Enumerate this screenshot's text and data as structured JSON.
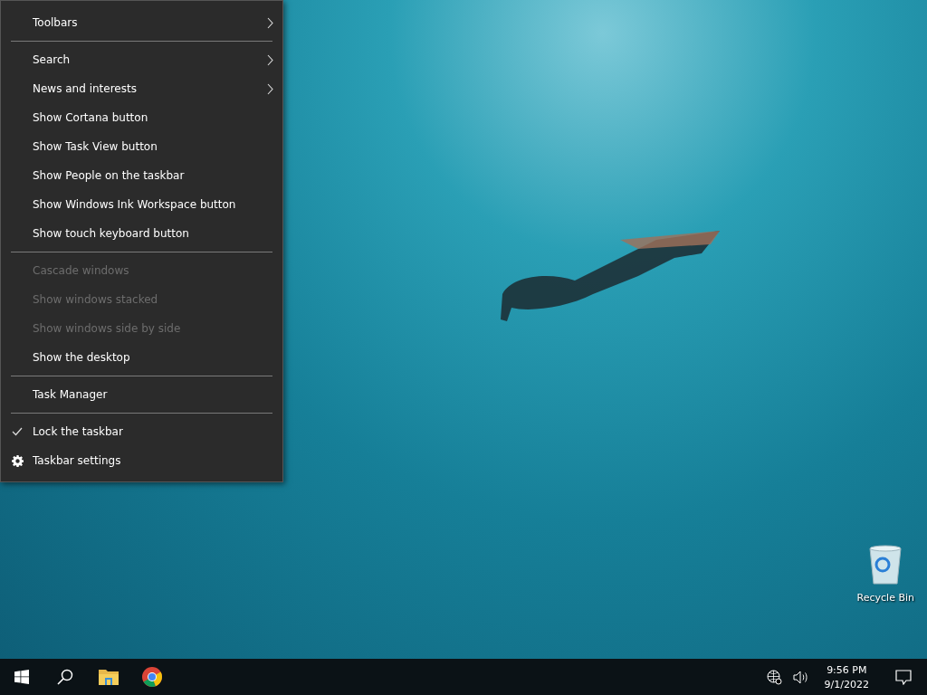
{
  "context_menu": {
    "items": [
      {
        "kind": "submenu",
        "label": "Toolbars",
        "disabled": false
      },
      {
        "kind": "separator"
      },
      {
        "kind": "submenu",
        "label": "Search",
        "disabled": false
      },
      {
        "kind": "submenu",
        "label": "News and interests",
        "disabled": false
      },
      {
        "kind": "command",
        "label": "Show Cortana button",
        "disabled": false
      },
      {
        "kind": "command",
        "label": "Show Task View button",
        "disabled": false
      },
      {
        "kind": "command",
        "label": "Show People on the taskbar",
        "disabled": false
      },
      {
        "kind": "command",
        "label": "Show Windows Ink Workspace button",
        "disabled": false
      },
      {
        "kind": "command",
        "label": "Show touch keyboard button",
        "disabled": false
      },
      {
        "kind": "separator"
      },
      {
        "kind": "command",
        "label": "Cascade windows",
        "disabled": true
      },
      {
        "kind": "command",
        "label": "Show windows stacked",
        "disabled": true
      },
      {
        "kind": "command",
        "label": "Show windows side by side",
        "disabled": true
      },
      {
        "kind": "command",
        "label": "Show the desktop",
        "disabled": false
      },
      {
        "kind": "separator"
      },
      {
        "kind": "command",
        "label": "Task Manager",
        "disabled": false
      },
      {
        "kind": "separator"
      },
      {
        "kind": "toggle",
        "label": "Lock the taskbar",
        "disabled": false,
        "checked": true
      },
      {
        "kind": "settings",
        "label": "Taskbar settings",
        "disabled": false
      }
    ]
  },
  "desktop_icons": [
    {
      "label": "Recycle Bin"
    }
  ],
  "taskbar": {
    "clock": {
      "time": "9:56 PM",
      "date": "9/1/2022"
    }
  }
}
